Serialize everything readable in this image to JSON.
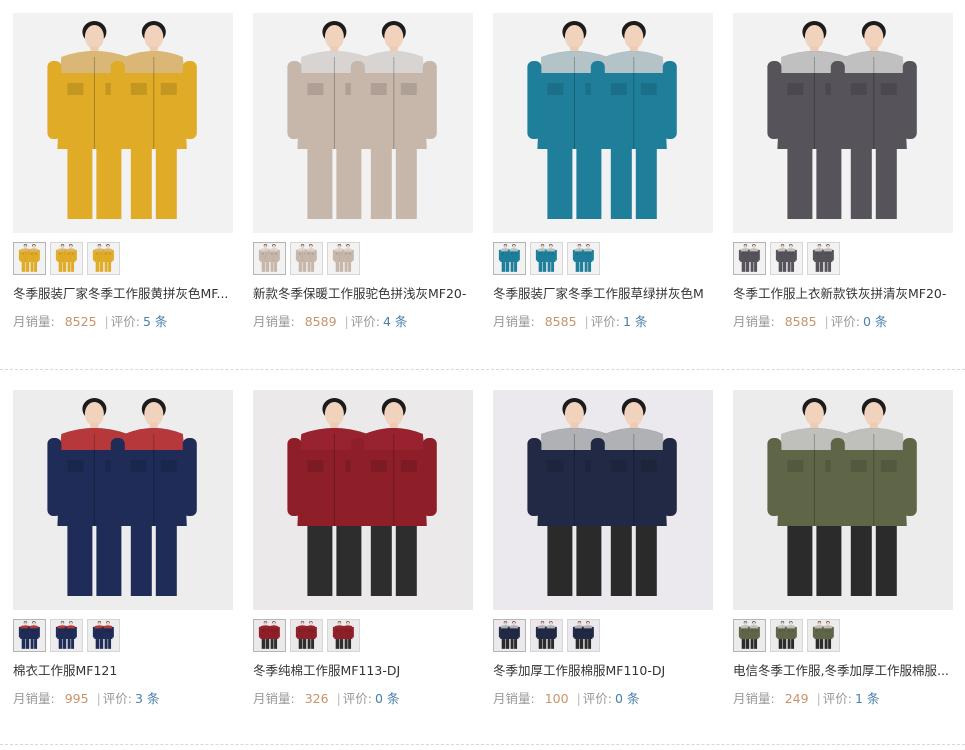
{
  "labels": {
    "sales": "月销量:",
    "reviews": "评价:",
    "unit": "条",
    "divider": "|"
  },
  "products": [
    {
      "title": "冬季服装厂家冬季工作服黄拼灰色MF...",
      "sales": "8525",
      "reviews": "5",
      "colors": {
        "main": "#e0ac27",
        "accent": "#d8b986",
        "pants": "#e0ac27",
        "bg": "#f2f2f2"
      }
    },
    {
      "title": "新款冬季保暖工作服驼色拼浅灰MF20-",
      "sales": "8589",
      "reviews": "4",
      "colors": {
        "main": "#c7b7aa",
        "accent": "#d9d9d9",
        "pants": "#c7b7aa",
        "bg": "#f2f2f2"
      }
    },
    {
      "title": "冬季服装厂家冬季工作服草绿拼灰色M",
      "sales": "8585",
      "reviews": "1",
      "colors": {
        "main": "#1f7f9b",
        "accent": "#cfcfcf",
        "pants": "#1f7f9b",
        "bg": "#f2f2f2"
      }
    },
    {
      "title": "冬季工作服上衣新款铁灰拼清灰MF20-",
      "sales": "8585",
      "reviews": "0",
      "colors": {
        "main": "#56535a",
        "accent": "#d3d3d3",
        "pants": "#56535a",
        "bg": "#f2f2f2"
      }
    },
    {
      "title": "棉衣工作服MF121",
      "sales": "995",
      "reviews": "3",
      "colors": {
        "main": "#1e2c57",
        "accent": "#d23b36",
        "pants": "#1e2c57",
        "bg": "#ededed"
      }
    },
    {
      "title": "冬季纯棉工作服MF113-DJ",
      "sales": "326",
      "reviews": "0",
      "colors": {
        "main": "#8e1f28",
        "accent": "#9a2530",
        "pants": "#2d2d2d",
        "bg": "#ece9ea"
      }
    },
    {
      "title": "冬季加厚工作服棉服MF110-DJ",
      "sales": "100",
      "reviews": "0",
      "colors": {
        "main": "#212944",
        "accent": "#c9c9c9",
        "pants": "#2a2a2a",
        "bg": "#ece9ee"
      }
    },
    {
      "title": "电信冬季工作服,冬季加厚工作服棉服...",
      "sales": "249",
      "reviews": "1",
      "colors": {
        "main": "#5f6648",
        "accent": "#d0d0d0",
        "pants": "#2b2b2b",
        "bg": "#ececec"
      }
    }
  ]
}
